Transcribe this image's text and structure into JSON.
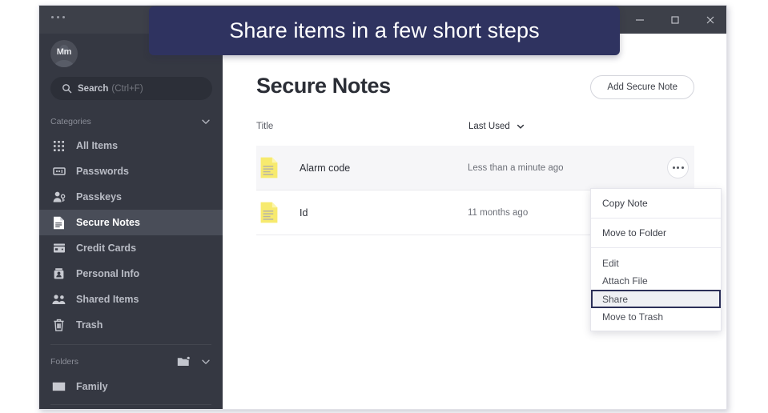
{
  "banner": {
    "text": "Share items in a few short steps",
    "bg_color": "#2f3360",
    "text_color": "#ffffff"
  },
  "window": {
    "titlebar": {
      "menu_dots": "overflow-dots",
      "minimize": "minimize",
      "maximize": "maximize",
      "close": "close"
    },
    "bg_color": "#ffffff"
  },
  "sidebar": {
    "bg_color": "#353842",
    "avatar": {
      "initials": "Mm"
    },
    "search": {
      "label": "Search",
      "hint": "(Ctrl+F)"
    },
    "categories_section": {
      "title": "Categories",
      "items": [
        {
          "label": "All Items",
          "icon": "grid-icon",
          "selected": false
        },
        {
          "label": "Passwords",
          "icon": "password-icon",
          "selected": false
        },
        {
          "label": "Passkeys",
          "icon": "passkey-icon",
          "selected": false
        },
        {
          "label": "Secure Notes",
          "icon": "note-icon",
          "selected": true
        },
        {
          "label": "Credit Cards",
          "icon": "credit-card-icon",
          "selected": false
        },
        {
          "label": "Personal Info",
          "icon": "personal-info-icon",
          "selected": false
        },
        {
          "label": "Shared Items",
          "icon": "shared-items-icon",
          "selected": false
        },
        {
          "label": "Trash",
          "icon": "trash-icon",
          "selected": false
        }
      ]
    },
    "folders_section": {
      "title": "Folders",
      "items": [
        {
          "label": "Family",
          "icon": "folder-icon"
        }
      ]
    }
  },
  "main": {
    "page_title": "Secure Notes",
    "add_button": "Add Secure Note",
    "columns": {
      "title": "Title",
      "last_used": "Last Used"
    },
    "rows": [
      {
        "title": "Alarm code",
        "last_used": "Less than a minute ago",
        "icon": "secure-note-icon",
        "highlighted": true
      },
      {
        "title": "Id",
        "last_used": "11 months ago",
        "icon": "secure-note-icon",
        "highlighted": false
      }
    ]
  },
  "context_menu": {
    "primary": [
      {
        "label": "Copy Note"
      },
      {
        "label": "Move to Folder"
      }
    ],
    "secondary": [
      {
        "label": "Edit",
        "selected": false
      },
      {
        "label": "Attach File",
        "selected": false
      },
      {
        "label": "Share",
        "selected": true
      },
      {
        "label": "Move to Trash",
        "selected": false
      }
    ],
    "highlight_color": "#2b2f58"
  }
}
